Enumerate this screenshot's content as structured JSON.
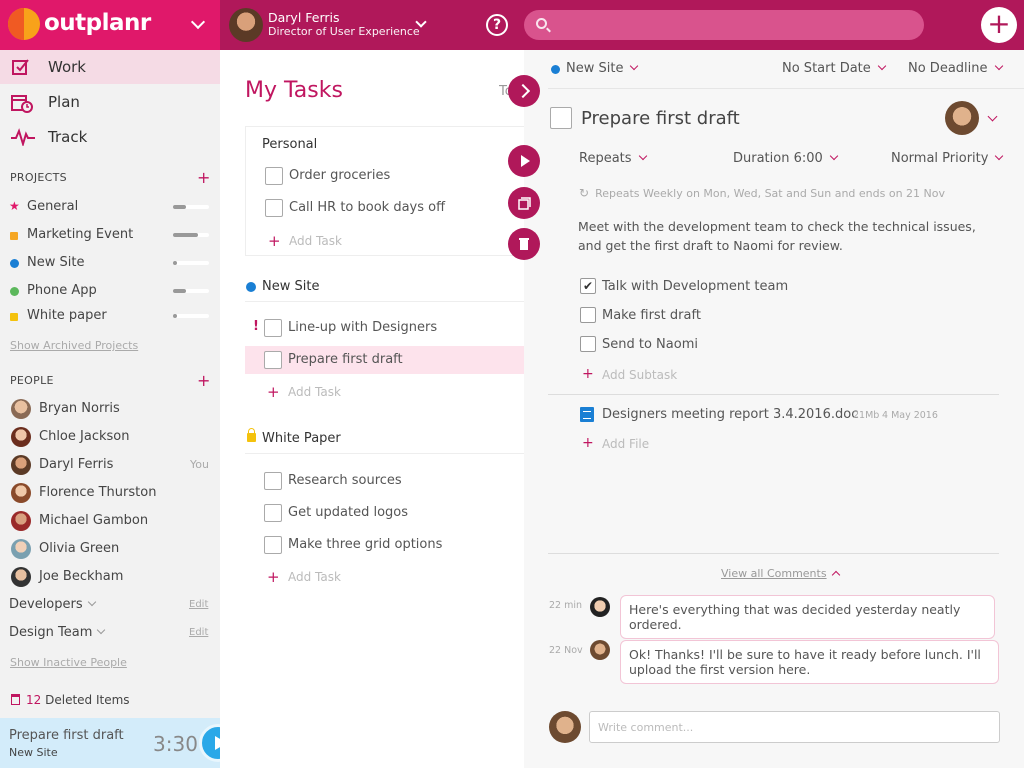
{
  "brand": {
    "name": "outplanr"
  },
  "user": {
    "name": "Daryl Ferris",
    "role": "Director of User Experience"
  },
  "help": {
    "label": "?"
  },
  "search": {
    "placeholder": ""
  },
  "add": {
    "label": "+"
  },
  "nav": [
    {
      "label": "Work",
      "icon": "checklist-icon"
    },
    {
      "label": "Plan",
      "icon": "calendar-icon"
    },
    {
      "label": "Track",
      "icon": "pulse-icon"
    }
  ],
  "projects": {
    "heading": "PROJECTS",
    "add": "+",
    "items": [
      {
        "label": "General",
        "color": "#e0186a",
        "shape": "star",
        "progress": 0.35
      },
      {
        "label": "Marketing Event",
        "color": "#f5a623",
        "shape": "lock",
        "progress": 0.7
      },
      {
        "label": "New Site",
        "color": "#1a7fd4",
        "shape": "dot",
        "progress": 0.1
      },
      {
        "label": "Phone App",
        "color": "#5cb85c",
        "shape": "dot",
        "progress": 0.35
      },
      {
        "label": "White paper",
        "color": "#f4c20d",
        "shape": "lock",
        "progress": 0.1
      }
    ],
    "archived_link": "Show Archived Projects"
  },
  "people": {
    "heading": "PEOPLE",
    "add": "+",
    "items": [
      {
        "name": "Bryan Norris",
        "tag": ""
      },
      {
        "name": "Chloe Jackson",
        "tag": ""
      },
      {
        "name": "Daryl Ferris",
        "tag": "You"
      },
      {
        "name": "Florence Thurston",
        "tag": ""
      },
      {
        "name": "Michael Gambon",
        "tag": ""
      },
      {
        "name": "Olivia Green",
        "tag": ""
      },
      {
        "name": "Joe Beckham",
        "tag": ""
      }
    ],
    "groups": [
      {
        "name": "Developers",
        "edit": "Edit"
      },
      {
        "name": "Design Team",
        "edit": "Edit"
      }
    ],
    "inactive_link": "Show Inactive People"
  },
  "deleted": {
    "count": "12",
    "label": "Deleted Items"
  },
  "timer": {
    "task": "Prepare first draft",
    "project": "New Site",
    "time": "3:30"
  },
  "middle": {
    "title": "My Tasks",
    "tab": "To",
    "personal": {
      "title": "Personal",
      "tasks": [
        "Order groceries",
        "Call HR to book days off"
      ],
      "add": "Add Task"
    },
    "groups": [
      {
        "title": "New Site",
        "tasks": [
          {
            "label": "Line-up with Designers",
            "flag": "!"
          },
          {
            "label": "Prepare first draft",
            "flag": ""
          }
        ],
        "add": "Add Task"
      },
      {
        "title": "White Paper",
        "tasks": [
          {
            "label": "Research sources",
            "flag": ""
          },
          {
            "label": "Get updated logos",
            "flag": ""
          },
          {
            "label": "Make three grid options",
            "flag": ""
          }
        ],
        "add": "Add Task"
      }
    ]
  },
  "detail": {
    "project": "New Site",
    "start": "No Start Date",
    "deadline": "No Deadline",
    "title": "Prepare first draft",
    "repeats": "Repeats",
    "duration": "Duration 6:00",
    "priority": "Normal Priority",
    "repeat_info": "Repeats Weekly on Mon, Wed, Sat and Sun and ends on 21 Nov",
    "description": "Meet with the development team to check the technical issues, and get the first draft to Naomi for review.",
    "subtasks": [
      {
        "label": "Talk with Development team",
        "checked": "✔"
      },
      {
        "label": "Make first draft",
        "checked": ""
      },
      {
        "label": "Send to Naomi",
        "checked": ""
      }
    ],
    "add_subtask": "Add Subtask",
    "file": {
      "name": "Designers meeting report 3.4.2016.doc",
      "size": "21Mb",
      "date": "4 May 2016"
    },
    "add_file": "Add File",
    "view_comments": "View all Comments",
    "comments": [
      {
        "time": "22 min",
        "text": "Here's everything that was decided yesterday neatly ordered."
      },
      {
        "time": "22 Nov",
        "text": "Ok! Thanks! I'll be sure to have it ready before lunch. I'll upload the first version here."
      }
    ],
    "comment_placeholder": "Write comment..."
  }
}
